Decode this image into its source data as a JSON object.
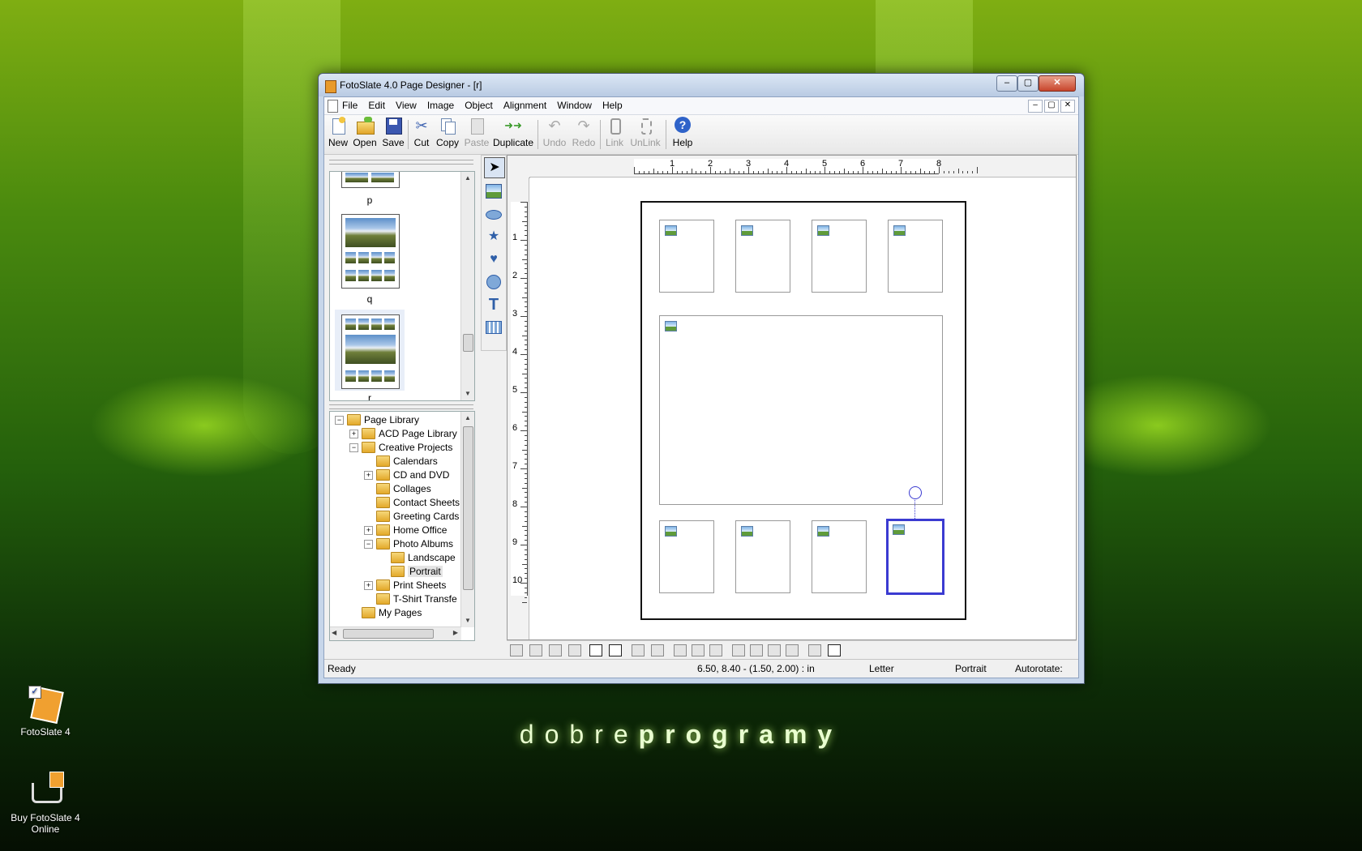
{
  "window": {
    "title": "FotoSlate 4.0 Page Designer - [r]",
    "controls": {
      "minimize": "–",
      "maximize": "▢",
      "close": "✕"
    }
  },
  "menu": [
    "File",
    "Edit",
    "View",
    "Image",
    "Object",
    "Alignment",
    "Window",
    "Help"
  ],
  "toolbar": {
    "new": "New",
    "open": "Open",
    "save": "Save",
    "cut": "Cut",
    "copy": "Copy",
    "paste": "Paste",
    "duplicate": "Duplicate",
    "undo": "Undo",
    "redo": "Redo",
    "link": "Link",
    "unlink": "UnLink",
    "help": "Help"
  },
  "thumbnails": {
    "labels": [
      "p",
      "q",
      "r"
    ]
  },
  "tree": {
    "items": [
      {
        "label": "Page Library",
        "expander": "−"
      },
      {
        "label": "ACD Page Library",
        "expander": "+"
      },
      {
        "label": "Creative Projects",
        "expander": "−"
      },
      {
        "label": "Calendars",
        "expander": ""
      },
      {
        "label": "CD and DVD",
        "expander": "+"
      },
      {
        "label": "Collages",
        "expander": ""
      },
      {
        "label": "Contact Sheets",
        "expander": ""
      },
      {
        "label": "Greeting Cards",
        "expander": ""
      },
      {
        "label": "Home Office",
        "expander": "+"
      },
      {
        "label": "Photo Albums",
        "expander": "−"
      },
      {
        "label": "Landscape",
        "expander": ""
      },
      {
        "label": "Portrait",
        "expander": ""
      },
      {
        "label": "Print Sheets",
        "expander": "+"
      },
      {
        "label": "T-Shirt Transfe",
        "expander": ""
      },
      {
        "label": "My Pages",
        "expander": ""
      }
    ]
  },
  "tools": [
    "pointer-tool",
    "image-tool",
    "ellipse-tool",
    "star-tool",
    "shape-tool",
    "rotate-tool",
    "text-tool",
    "grid-tool"
  ],
  "ruler": {
    "horizontal": [
      "1",
      "2",
      "3",
      "4",
      "5",
      "6",
      "7",
      "8"
    ],
    "vertical": [
      "1",
      "2",
      "3",
      "4",
      "5",
      "6",
      "7",
      "8",
      "9",
      "10"
    ]
  },
  "status": {
    "ready": "Ready",
    "coords": "6.50, 8.40 - (1.50, 2.00) : in",
    "paper": "Letter",
    "orientation": "Portrait",
    "autorotate": "Autorotate:"
  },
  "desktop": {
    "icon1": "FotoSlate 4",
    "icon2_line1": "Buy FotoSlate 4",
    "icon2_line2": "Online"
  },
  "watermark": {
    "light": "dobre",
    "bold": "programy"
  },
  "colors": {
    "selection": "#3b3bd1",
    "window_frame": "#c7d6ea",
    "wallpaper": "#3d7a10"
  }
}
